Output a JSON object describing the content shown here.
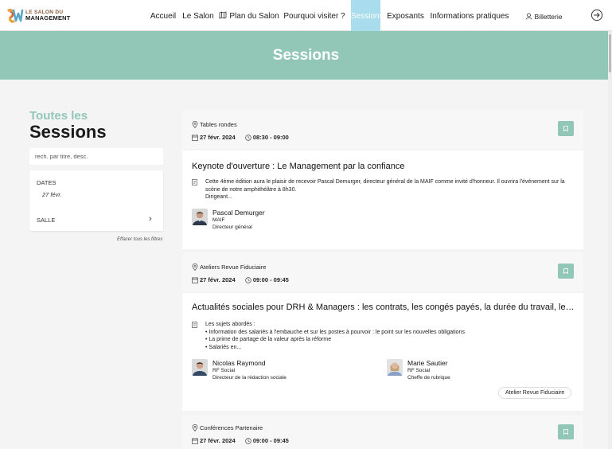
{
  "nav": {
    "logo_line1": "LE SALON DU",
    "logo_line2": "MANAGEMENT",
    "items": [
      {
        "label": "Accueil"
      },
      {
        "label": "Le Salon"
      },
      {
        "label": "Plan du Salon",
        "icon": "map-icon"
      },
      {
        "label": "Pourquoi visiter ?"
      },
      {
        "label": "Sessions",
        "active": true
      },
      {
        "label": "Exposants"
      },
      {
        "label": "Informations pratiques"
      },
      {
        "label": "Billetterie",
        "icon": "user-icon"
      }
    ],
    "logout_icon": "logout-icon"
  },
  "hero": {
    "title": "Sessions"
  },
  "sidebar": {
    "heading_top": "Toutes les",
    "heading_bottom": "Sessions",
    "search_placeholder": "rech. par titre, desc.",
    "filters": {
      "dates_label": "DATES",
      "dates_value": "27 févr.",
      "salle_label": "SALLE"
    },
    "clear_filters": "Effacer tous les filtres"
  },
  "sessions": [
    {
      "category": "Tables rondes",
      "date": "27 févr. 2024",
      "time": "08:30 - 09:00",
      "title": "Keynote d'ouverture : Le Management par la confiance",
      "description": [
        "Cette 4ème édition aura le plaisir de recevoir Pascal Demurger, directeur général de la MAIF comme invité d'honneur. Il ouvrira l'événement sur la scène de notre amphithéâtre à 8h30.",
        "Dirigeant..."
      ],
      "speakers": [
        {
          "name": "Pascal Demurger",
          "company": "MAIF",
          "role": "Directeur général"
        }
      ]
    },
    {
      "category": "Ateliers Revue Fiduciaire",
      "date": "27 févr. 2024",
      "time": "09:00 - 09:45",
      "title": "Actualités sociales pour DRH & Managers : les contrats, les congés payés, la durée du travail, les...",
      "description": [
        "Les sujets abordés :",
        "• Information des salariés à l'embauche et sur les postes à pourvoir : le point sur les nouvelles obligations",
        "• La prime de partage de la valeur après la réforme",
        "• Salariés en..."
      ],
      "speakers": [
        {
          "name": "Nicolas Raymond",
          "company": "RF Social",
          "role": "Directeur de la rédaction sociale"
        },
        {
          "name": "Marie Sautier",
          "company": "RF Social",
          "role": "Cheffe de rubrique"
        }
      ],
      "tag": "Atelier Revue Fiduciaire"
    },
    {
      "category": "Conférences Partenaire",
      "date": "27 févr. 2024",
      "time": "09:00 - 09:45"
    }
  ],
  "colors": {
    "accent": "#92c6b7",
    "nav_active": "#a9dcec",
    "page_bg": "#f4f4f4"
  }
}
